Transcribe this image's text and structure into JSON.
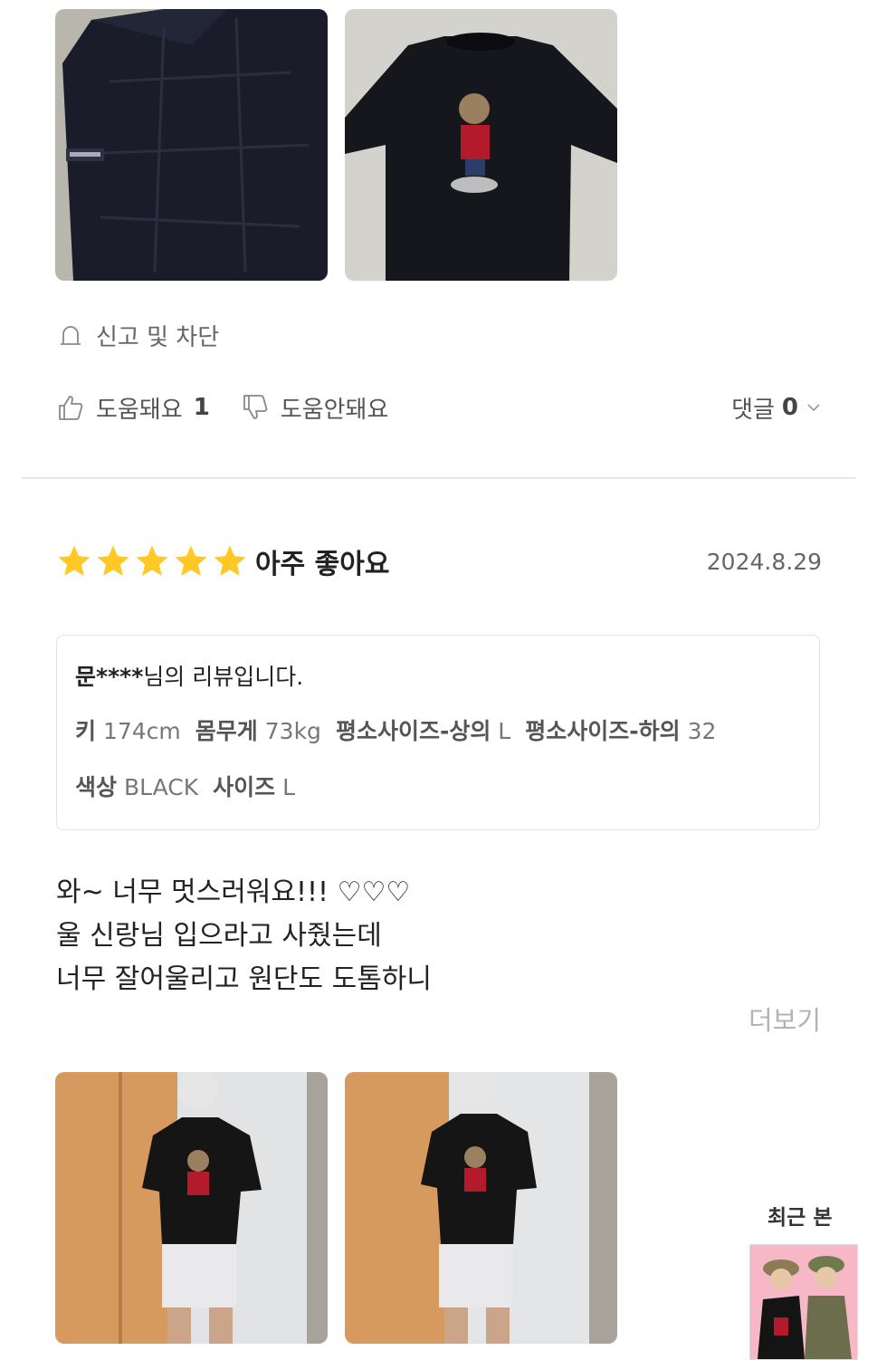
{
  "report": {
    "label": "신고 및 차단"
  },
  "votes": {
    "helpful_label": "도움돼요",
    "helpful_count": "1",
    "unhelpful_label": "도움안돼요",
    "comments_label": "댓글",
    "comments_count": "0"
  },
  "review": {
    "stars": 5,
    "rating_label": "아주 좋아요",
    "date": "2024.8.29",
    "reviewer_name": "문****",
    "reviewer_suffix": "님의 리뷰입니다.",
    "specs": {
      "height_key": "키",
      "height_val": "174cm",
      "weight_key": "몸무게",
      "weight_val": "73kg",
      "top_key": "평소사이즈-상의",
      "top_val": "L",
      "bottom_key": "평소사이즈-하의",
      "bottom_val": "32",
      "color_key": "색상",
      "color_val": "BLACK",
      "size_key": "사이즈",
      "size_val": "L"
    },
    "body_lines": [
      "와~ 너무 멋스러워요!!! ♡♡♡",
      "울 신랑님 입으라고 사줬는데",
      "너무 잘어울리고 원단도 도톰하니"
    ],
    "more_label": "더보기"
  },
  "recent": {
    "label": "최근 본"
  },
  "colors": {
    "star": "#FFC825",
    "divider": "#e6e6e6",
    "muted": "#b3b3b3"
  }
}
